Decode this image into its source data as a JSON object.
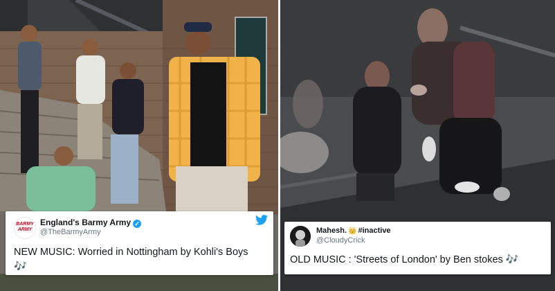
{
  "left_panel": {
    "photo_icon": "group-photo-on-stairs",
    "tweet": {
      "avatar_logo_line1": "BARMY",
      "avatar_logo_line2": "ARMY",
      "display_name": "England's Barmy Army",
      "handle": "@TheBarmyArmy",
      "verified": true,
      "text": "NEW MUSIC: Worried in Nottingham by Kohli's Boys",
      "emoji": "🎶",
      "platform_icon": "twitter-bird-icon"
    }
  },
  "right_panel": {
    "photo_icon": "blurry-night-street-scuffle",
    "tweet": {
      "display_name": "Mahesh.",
      "name_emoji": "👑",
      "name_suffix": "#inactive",
      "handle": "@CloudyCrick",
      "text": "OLD MUSIC : 'Streets of London' by Ben stokes",
      "emoji": "🎶"
    }
  },
  "colors": {
    "twitter_blue": "#1da1f2",
    "handle_grey": "#657786",
    "text_dark": "#14171a",
    "logo_red": "#d0021b"
  }
}
